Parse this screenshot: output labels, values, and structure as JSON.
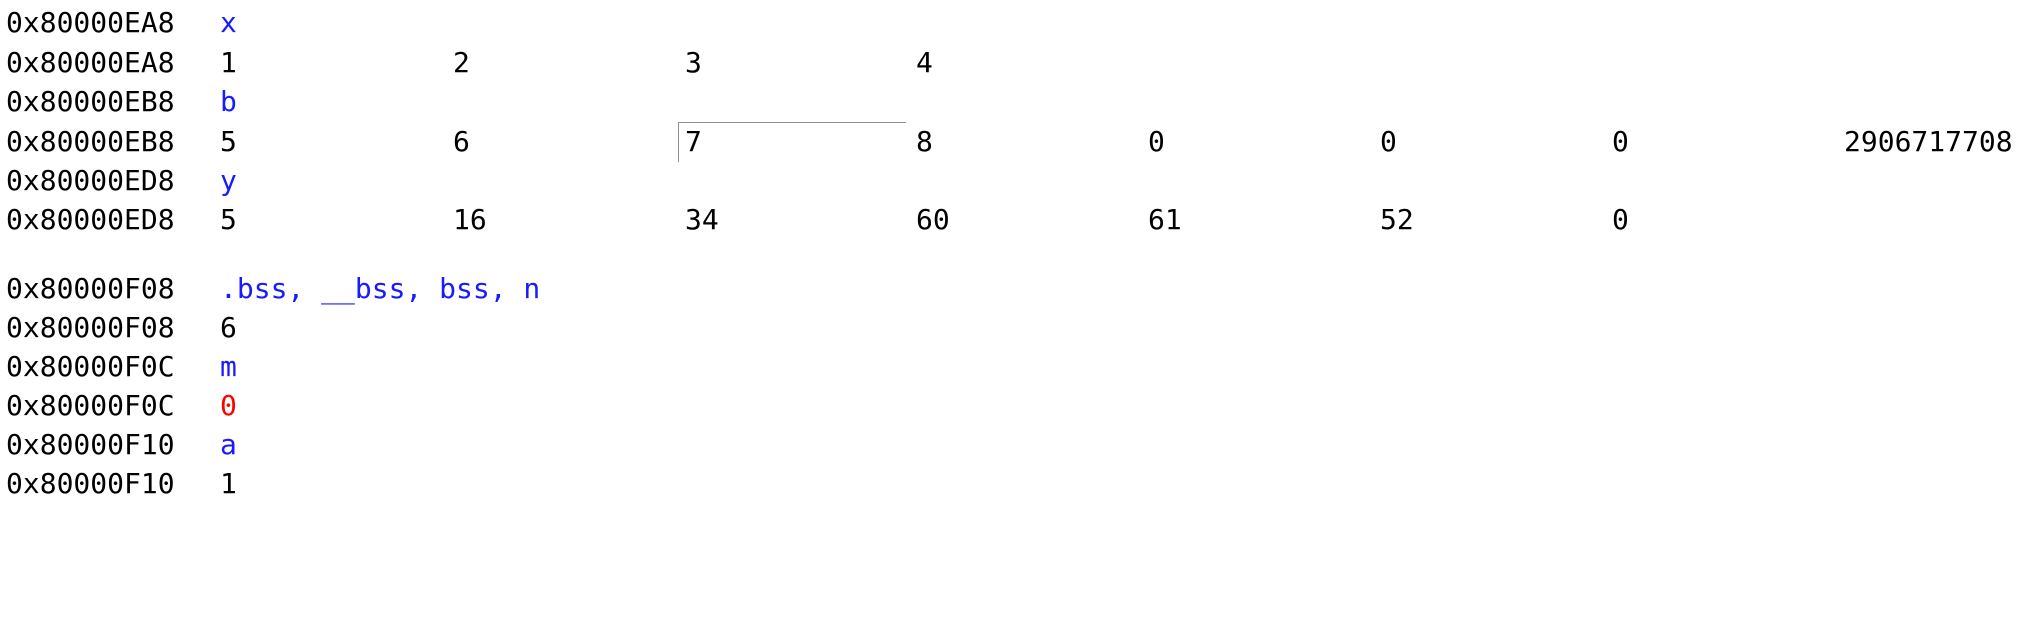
{
  "rows": [
    {
      "address": "0x80000EA8",
      "symbol": "x"
    },
    {
      "address": "0x80000EA8",
      "values": [
        "1",
        "2",
        "3",
        "4"
      ]
    },
    {
      "address": "0x80000EB8",
      "symbol": "b"
    },
    {
      "address": "0x80000EB8",
      "values": [
        "5",
        "6",
        "7",
        "8",
        "0",
        "0",
        "0",
        "2906717708"
      ]
    },
    {
      "address": "0x80000ED8",
      "symbol": "y"
    },
    {
      "address": "0x80000ED8",
      "values": [
        "5",
        "16",
        "34",
        "60",
        "61",
        "52",
        "0"
      ]
    },
    {
      "address": "0x80000F08",
      "symbol": ".bss, __bss, bss, n"
    },
    {
      "address": "0x80000F08",
      "values": [
        "6"
      ]
    },
    {
      "address": "0x80000F0C",
      "symbol": "m"
    },
    {
      "address": "0x80000F0C",
      "values": [
        "0"
      ],
      "value_color": "#ff0000"
    },
    {
      "address": "0x80000F10",
      "symbol": "a"
    },
    {
      "address": "0x80000F10",
      "values": [
        "1"
      ]
    }
  ],
  "colors": {
    "symbol": "#1a1aff",
    "changed_value": "#ff0000",
    "value": "#000000"
  }
}
